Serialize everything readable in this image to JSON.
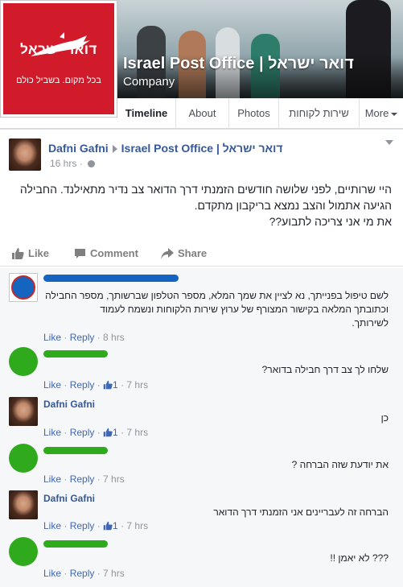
{
  "page": {
    "title": "Israel Post Office | דואר ישראל",
    "category": "Company",
    "logo_text": "דואר ישראל",
    "logo_slogan": "בכל מקום. בשביל כולם"
  },
  "tabs": [
    {
      "label": "Timeline",
      "active": true
    },
    {
      "label": "About"
    },
    {
      "label": "Photos"
    },
    {
      "label": "שירות לקוחות"
    },
    {
      "label": "More"
    }
  ],
  "post": {
    "author": "Dafni Gafni",
    "target": "Israel Post Office | דואר ישראל",
    "time": "16 hrs",
    "text_lines": [
      "היי שרותיים, לפני שלושה חודשים הזמנתי דרך הדואר צב נדיר מתאילנד. החבילה",
      "הגיעה אתמול והצב נמצא בריקבון מתקדם.",
      "את מי אני צריכה לתבוע??"
    ],
    "actions": {
      "like": "Like",
      "comment": "Comment",
      "share": "Share"
    }
  },
  "comments": [
    {
      "author": "",
      "text_lines": [
        "לשם טיפול בפנייתך, נא לציין את שמך המלא, מספר הטלפון שברשותך, מספר החבילה",
        "וכתובתך המלאה בקישור המצורף של ערוץ שירות הלקוחות ונשמח לעמוד",
        "לשירותך."
      ],
      "like": "Like",
      "reply": "Reply",
      "likes": "",
      "time": "8 hrs"
    },
    {
      "author": "",
      "text_lines": [
        "שלחו לך צב דרך חבילה בדואר?"
      ],
      "like": "Like",
      "reply": "Reply",
      "likes": "1",
      "time": "7 hrs"
    },
    {
      "author": "Dafni Gafni",
      "text_lines": [
        "כן"
      ],
      "like": "Like",
      "reply": "Reply",
      "likes": "1",
      "time": "7 hrs"
    },
    {
      "author": "",
      "text_lines": [
        "את יודעת שזה הברחה ?"
      ],
      "like": "Like",
      "reply": "Reply",
      "likes": "",
      "time": "7 hrs"
    },
    {
      "author": "Dafni Gafni",
      "text_lines": [
        "הברחה זה לעבריינים אני הזמנתי דרך הדואר"
      ],
      "like": "Like",
      "reply": "Reply",
      "likes": "1",
      "time": "7 hrs"
    },
    {
      "author": "",
      "text_lines": [
        "??? לא יאמן !!"
      ],
      "like": "Like",
      "reply": "Reply",
      "likes": "",
      "time": "7 hrs"
    }
  ],
  "colors": {
    "brand_red": "#d11a2a",
    "link_blue": "#365899",
    "redaction_blue": "#1565c0",
    "redaction_green": "#2eaa1c"
  }
}
